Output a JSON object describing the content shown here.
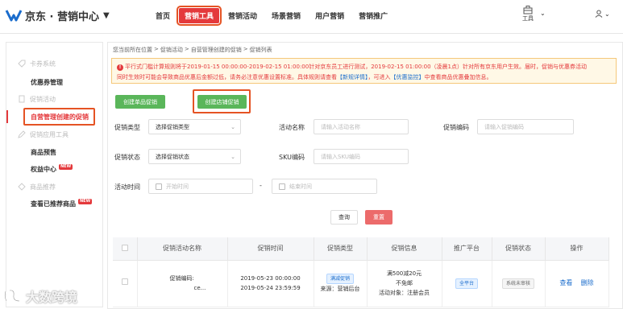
{
  "header": {
    "logo_text": "京东 · 营销中心",
    "nav": [
      "首页",
      "营销工具",
      "营销活动",
      "场景营销",
      "用户营销",
      "营销推广"
    ],
    "tools_label": "工具"
  },
  "sidebar": {
    "groups": [
      "卡券系统",
      "促销活动",
      "促销应用工具",
      "商品推荐"
    ],
    "items": [
      "优惠券管理",
      "自营管理创建的促销",
      "商品预售",
      "权益中心",
      "查看已推荐商品"
    ],
    "new_badge": "NEW"
  },
  "breadcrumb": [
    "您当前所在位置",
    ">",
    "促销活动",
    ">",
    "自营管理创建的促销",
    ">",
    "促销列表"
  ],
  "notice": {
    "line1": "平行式门槛计算规则将于2019-01-15 00:00:00-2019-02-15 01:00:00针对京东员工进行测试，2019-02-15 01:00:00（凌晨1点）针对所有京东用户生效。届时，促销与优惠券活动",
    "line2_a": "同时生效时可能会导致商品优惠后金额过低，请务必注意优惠设置标准。具体规则请查看",
    "link1": "【新规详情】",
    "line2_b": "，可进入",
    "link2": "【优惠监控】",
    "line2_c": "中查看商品优惠叠加信息。"
  },
  "buttons": {
    "create_sku": "创建单品促销",
    "create_shop": "创建店铺促销",
    "query": "查询",
    "reset": "重置"
  },
  "filters": {
    "type_label": "促销类型",
    "type_value": "选择促销类型",
    "name_label": "活动名称",
    "name_placeholder": "请输入活动名称",
    "code_label": "促销编码",
    "code_placeholder": "请输入促销编码",
    "status_label": "促销状态",
    "status_value": "选择促销状态",
    "sku_label": "SKU编码",
    "sku_placeholder": "请输入SKU编码",
    "time_label": "活动时间",
    "start_placeholder": "开始时间",
    "dash": "-",
    "end_placeholder": "结束时间"
  },
  "table": {
    "headers": [
      "",
      "促销活动名称",
      "促销时间",
      "促销类型",
      "促销信息",
      "推广平台",
      "促销状态",
      "操作"
    ],
    "rows": [
      {
        "name_line1": "促销编码:",
        "name_line2": "ce...",
        "time_start": "2019-05-23 00:00:00",
        "time_end": "2019-05-24 23:59:59",
        "type_tag": "满减促销",
        "type_source": "来源：营销后台",
        "info_line1": "满500减20元",
        "info_line2": "不免邮",
        "info_line3": "活动对象：注册会员",
        "platform": "全平台",
        "status": "系统未审核",
        "op_view": "查看",
        "op_delete": "删除"
      }
    ]
  },
  "watermark": "大数跨境",
  "colors": {
    "accent": "#e4393c",
    "green": "#5ab65a",
    "highlight": "#e55324",
    "link": "#1a6ccc"
  }
}
